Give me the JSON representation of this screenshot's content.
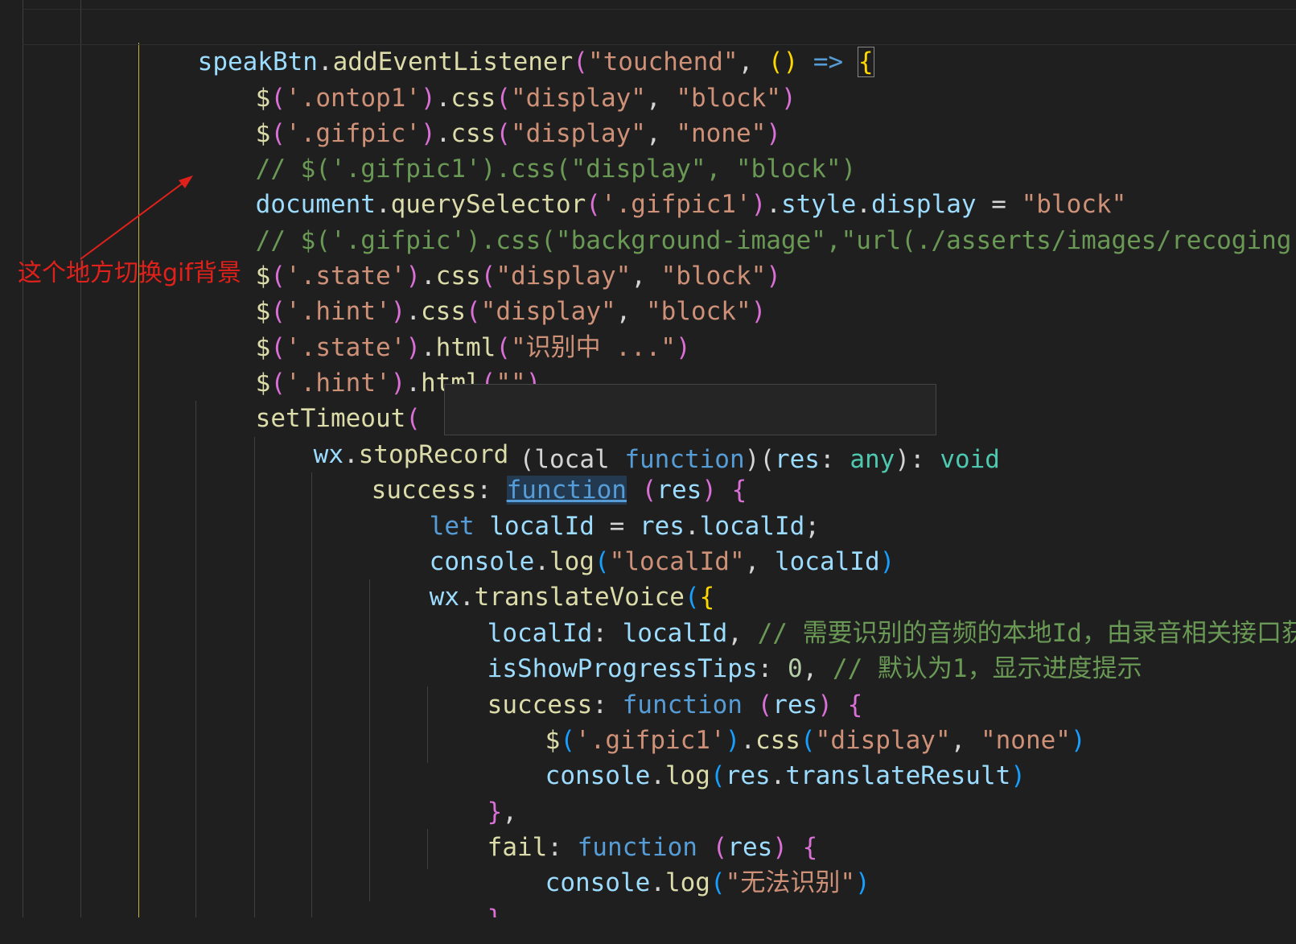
{
  "colors": {
    "background": "#1f1f1f",
    "variable": "#9cdcfe",
    "function": "#dcdcaa",
    "string": "#ce9178",
    "comment": "#6a9955",
    "keyword": "#569cd6",
    "type": "#4ec9b0",
    "bracket_level_1": "#ffd700",
    "bracket_level_2": "#da70d6",
    "bracket_level_3": "#179fff",
    "annotation": "#e0211b"
  },
  "annotation": {
    "text": "这个地方切换gif背景"
  },
  "tooltip": {
    "open_paren": "(",
    "kind_label": "local",
    "kind_keyword": "function",
    "close_paren": ")",
    "params_open": "(",
    "param_name": "res",
    "param_colon": ": ",
    "param_type": "any",
    "params_close": ")",
    "return_colon": ": ",
    "return_type": "void"
  },
  "code": {
    "l01": {
      "t1": "speakBtn",
      "t2": ".",
      "t3": "addEventListener",
      "t4": "(",
      "t5": "\"touchend\"",
      "t6": ", ",
      "t7": "()",
      "t8": " => ",
      "t9": "{"
    },
    "l02": {
      "t1": "$",
      "t2": "(",
      "t3": "'.ontop1'",
      "t4": ")",
      "t5": ".",
      "t6": "css",
      "t7": "(",
      "t8": "\"display\"",
      "t9": ", ",
      "t10": "\"block\"",
      "t11": ")"
    },
    "l03": {
      "t1": "$",
      "t2": "(",
      "t3": "'.gifpic'",
      "t4": ")",
      "t5": ".",
      "t6": "css",
      "t7": "(",
      "t8": "\"display\"",
      "t9": ", ",
      "t10": "\"none\"",
      "t11": ")"
    },
    "l04": {
      "t1": "// $('.gifpic1').css(\"display\", \"block\")"
    },
    "l05": {
      "t1": "document",
      "t2": ".",
      "t3": "querySelector",
      "t4": "(",
      "t5": "'.gifpic1'",
      "t6": ")",
      "t7": ".",
      "t8": "style",
      "t9": ".",
      "t10": "display",
      "t11": " = ",
      "t12": "\"block\""
    },
    "l06": {
      "t1": "// $('.gifpic').css(\"background-image\",\"url(./asserts/images/recoging.gif)"
    },
    "l07": {
      "t1": "$",
      "t2": "(",
      "t3": "'.state'",
      "t4": ")",
      "t5": ".",
      "t6": "css",
      "t7": "(",
      "t8": "\"display\"",
      "t9": ", ",
      "t10": "\"block\"",
      "t11": ")"
    },
    "l08": {
      "t1": "$",
      "t2": "(",
      "t3": "'.hint'",
      "t4": ")",
      "t5": ".",
      "t6": "css",
      "t7": "(",
      "t8": "\"display\"",
      "t9": ", ",
      "t10": "\"block\"",
      "t11": ")"
    },
    "l09": {
      "t1": "$",
      "t2": "(",
      "t3": "'.state'",
      "t4": ")",
      "t5": ".",
      "t6": "html",
      "t7": "(",
      "t8": "\"识别中 ...\"",
      "t9": ")"
    },
    "l10": {
      "t1": "$",
      "t2": "(",
      "t3": "'.hint'",
      "t4": ")",
      "t5": ".",
      "t6": "html",
      "t7": "(",
      "t8": "\"\"",
      "t9": ")"
    },
    "l11": {
      "t1": "setTimeout",
      "t2": "("
    },
    "l12": {
      "t1": "wx",
      "t2": ".",
      "t3": "stopRecord"
    },
    "l13": {
      "t1": "success",
      "t2": ": ",
      "t3": "function",
      "t4": " ",
      "t5": "(",
      "t6": "res",
      "t7": ")",
      "t8": " ",
      "t9": "{"
    },
    "l14": {
      "t1": "let",
      "t2": " ",
      "t3": "localId",
      "t4": " = ",
      "t5": "res",
      "t6": ".",
      "t7": "localId",
      "t8": ";"
    },
    "l15": {
      "t1": "console",
      "t2": ".",
      "t3": "log",
      "t4": "(",
      "t5": "\"localId\"",
      "t6": ", ",
      "t7": "localId",
      "t8": ")"
    },
    "l16": {
      "t1": "wx",
      "t2": ".",
      "t3": "translateVoice",
      "t4": "(",
      "t5": "{"
    },
    "l17": {
      "t1": "localId",
      "t2": ": ",
      "t3": "localId",
      "t4": ", ",
      "t5": "// 需要识别的音频的本地Id，由录音相关接口获"
    },
    "l18": {
      "t1": "isShowProgressTips",
      "t2": ": ",
      "t3": "0",
      "t4": ", ",
      "t5": "// 默认为1，显示进度提示"
    },
    "l19": {
      "t1": "success",
      "t2": ": ",
      "t3": "function",
      "t4": " ",
      "t5": "(",
      "t6": "res",
      "t7": ")",
      "t8": " ",
      "t9": "{"
    },
    "l20": {
      "t1": "$",
      "t2": "(",
      "t3": "'.gifpic1'",
      "t4": ")",
      "t5": ".",
      "t6": "css",
      "t7": "(",
      "t8": "\"display\"",
      "t9": ", ",
      "t10": "\"none\"",
      "t11": ")"
    },
    "l21": {
      "t1": "console",
      "t2": ".",
      "t3": "log",
      "t4": "(",
      "t5": "res",
      "t6": ".",
      "t7": "translateResult",
      "t8": ")"
    },
    "l22": {
      "t1": "}",
      "t2": ","
    },
    "l23": {
      "t1": "fail",
      "t2": ": ",
      "t3": "function",
      "t4": " ",
      "t5": "(",
      "t6": "res",
      "t7": ")",
      "t8": " ",
      "t9": "{"
    },
    "l24": {
      "t1": "console",
      "t2": ".",
      "t3": "log",
      "t4": "(",
      "t5": "\"无法识别\"",
      "t6": ")"
    },
    "l25": {
      "t1": "}"
    },
    "l26": {
      "t1": "})"
    }
  }
}
